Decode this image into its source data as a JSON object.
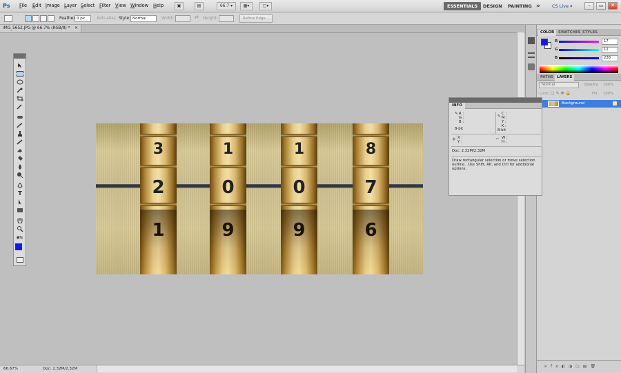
{
  "menubar": {
    "items": [
      "File",
      "Edit",
      "Image",
      "Layer",
      "Select",
      "Filter",
      "View",
      "Window",
      "Help"
    ],
    "zoom_value": "66.7",
    "workspaces": [
      "ESSENTIALS",
      "DESIGN",
      "PAINTING"
    ],
    "overflow": "»",
    "cs_live": "CS Live ▾"
  },
  "options": {
    "feather_label": "Feather:",
    "feather_value": "0 px",
    "anti_alias_label": "Anti-alias",
    "style_label": "Style:",
    "style_value": "Normal",
    "width_label": "Width:",
    "height_label": "Height:",
    "refine_edge": "Refine Edge..."
  },
  "document": {
    "tab_title": "IMG_5652.JPG @ 66.7% (RGB/8) *",
    "status_zoom": "66.67%",
    "status_doc": "Doc: 2.32M/2.32M"
  },
  "photo": {
    "wheels": [
      {
        "top": "3",
        "middle": "2",
        "bottom": "1"
      },
      {
        "top": "1",
        "middle": "0",
        "bottom": "9"
      },
      {
        "top": "1",
        "middle": "0",
        "bottom": "9"
      },
      {
        "top": "8",
        "middle": "7",
        "bottom": "6"
      }
    ]
  },
  "color_panel": {
    "tabs": [
      "COLOR",
      "SWATCHES",
      "STYLES"
    ],
    "foreground": "#1118ec",
    "r_label": "R",
    "g_label": "G",
    "b_label": "B",
    "r": "17",
    "g": "11",
    "b": "238"
  },
  "layers_panel": {
    "tabs": [
      "PATHS",
      "LAYERS"
    ],
    "blend_mode": "Normal",
    "opacity_label": "Opacity:",
    "opacity_value": "100%",
    "lock_label": "Lock:",
    "fill_label": "Fill:",
    "fill_value": "100%",
    "layer_name": "Background"
  },
  "info_panel": {
    "tab": "INFO",
    "rgb_left": "R :\nG :\nB :",
    "bit_left": "8-bit",
    "cmyk_right": "C :\nM :\nY :\nK :",
    "bit_right": "8-bit",
    "xy": "X :\nY :",
    "wh": "W :\nH :",
    "doc": "Doc: 2.32M/2.32M",
    "hint": "Draw rectangular selection or move selection\noutline.  Use Shift, Alt, and Ctrl for additional\noptions."
  }
}
